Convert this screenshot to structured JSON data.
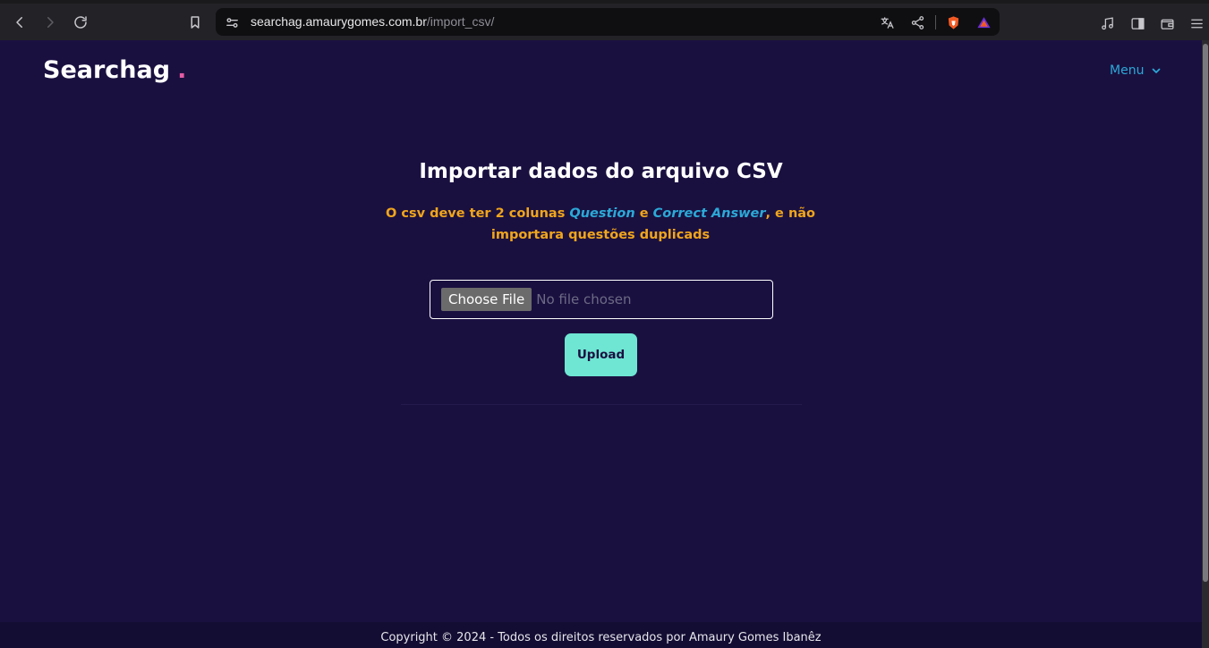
{
  "browser": {
    "url_domain": "searchag.amaurygomes.com.br",
    "url_path": "/import_csv/",
    "icons": [
      "back-icon",
      "forward-icon",
      "reload-icon",
      "bookmark-icon",
      "site-settings-icon",
      "translate-icon",
      "share-icon",
      "brave-shields-icon",
      "brave-rewards-icon",
      "media-icon",
      "sidebar-icon",
      "wallet-icon",
      "menu-icon"
    ]
  },
  "header": {
    "logo": "Searchag",
    "logo_dot": ".",
    "menu_label": "Menu"
  },
  "main": {
    "title": "Importar dados do arquivo CSV",
    "subtitle_part1": "O csv deve ter 2 colunas ",
    "subtitle_col1": "Question",
    "subtitle_part2": " e ",
    "subtitle_col2": "Correct Answer",
    "subtitle_part3": ", e não importara questões duplicads",
    "file_button_label": "Choose File",
    "file_status": "No file chosen",
    "upload_label": "Upload"
  },
  "footer": {
    "text": "Copyright © 2024 - Todos os direitos reservados por Amaury Gomes Ibanêz"
  },
  "colors": {
    "background": "#1a1040",
    "accent_blue": "#2ba9d8",
    "accent_orange": "#f0a51c",
    "upload_button": "#6ee6d3",
    "logo_dot": "#e35ba4"
  }
}
